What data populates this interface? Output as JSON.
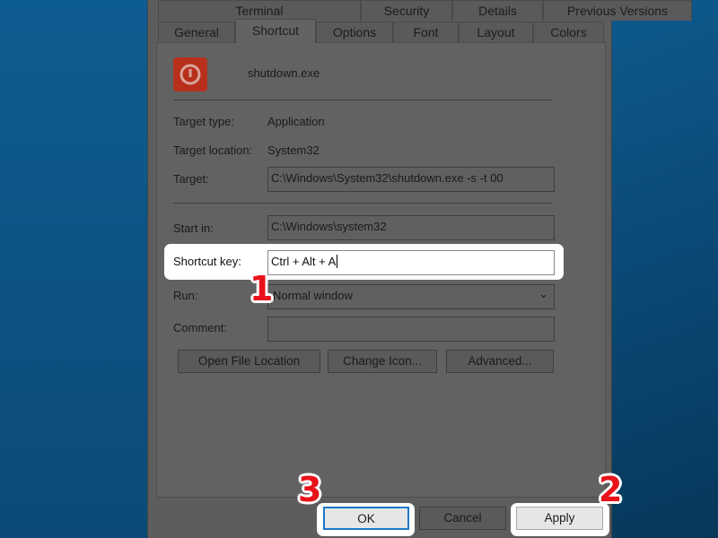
{
  "tabs_row1": [
    "Terminal",
    "Security",
    "Details",
    "Previous Versions"
  ],
  "tabs_row2": [
    "General",
    "Shortcut",
    "Options",
    "Font",
    "Layout",
    "Colors"
  ],
  "active_tab": "Shortcut",
  "file_name": "shutdown.exe",
  "icon": "power-icon",
  "fields": {
    "target_type_label": "Target type:",
    "target_type": "Application",
    "target_location_label": "Target location:",
    "target_location": "System32",
    "target_label": "Target:",
    "target": "C:\\Windows\\System32\\shutdown.exe -s -t 00",
    "start_in_label": "Start in:",
    "start_in": "C:\\Windows\\system32",
    "shortcut_key_label": "Shortcut key:",
    "shortcut_key": "Ctrl + Alt + A",
    "run_label": "Run:",
    "run": "Normal window",
    "comment_label": "Comment:",
    "comment": ""
  },
  "buttons": {
    "open_file_location": "Open File Location",
    "change_icon": "Change Icon...",
    "advanced": "Advanced...",
    "ok": "OK",
    "cancel": "Cancel",
    "apply": "Apply"
  },
  "annotations": [
    "1",
    "2",
    "3"
  ],
  "colors": {
    "annotation": "#e8121b",
    "icon_bg": "#b8301c"
  }
}
